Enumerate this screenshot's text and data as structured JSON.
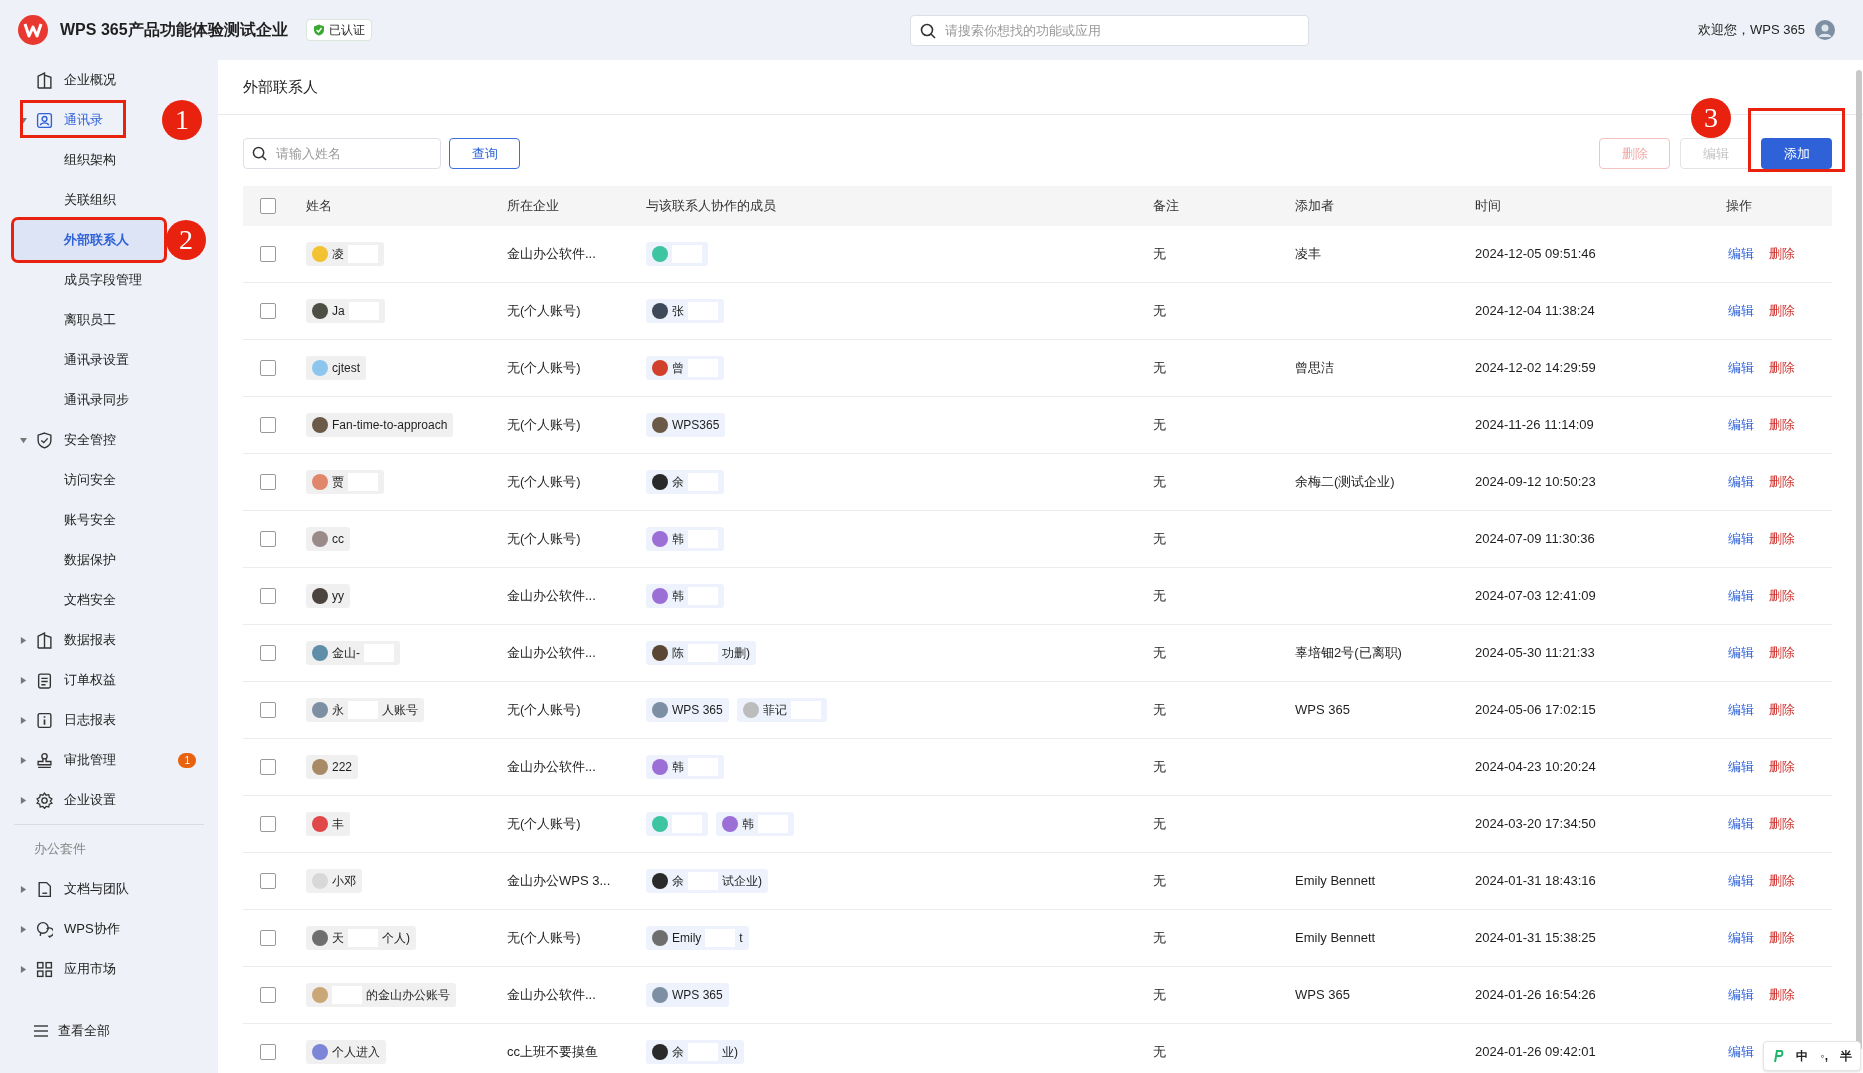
{
  "header": {
    "org_name": "WPS 365产品功能体验测试企业",
    "verified_badge": "已认证",
    "search": {
      "placeholder": "请搜索你想找的功能或应用"
    },
    "welcome": "欢迎您，WPS 365"
  },
  "sidebar": {
    "groups": [
      {
        "items": [
          {
            "label": "企业概况"
          },
          {
            "label": "通讯录",
            "expanded": true,
            "callout": "1",
            "children": [
              {
                "label": "组织架构",
                "selected": false
              },
              {
                "label": "关联组织",
                "selected": false
              },
              {
                "label": "外部联系人",
                "selected": true,
                "callout": "2"
              },
              {
                "label": "成员字段管理",
                "selected": false
              },
              {
                "label": "离职员工",
                "selected": false
              },
              {
                "label": "通讯录设置",
                "selected": false
              },
              {
                "label": "通讯录同步",
                "selected": false
              }
            ]
          },
          {
            "label": "安全管控",
            "expanded": true,
            "children": [
              {
                "label": "访问安全",
                "selected": false
              },
              {
                "label": "账号安全",
                "selected": false
              },
              {
                "label": "数据保护",
                "selected": false
              },
              {
                "label": "文档安全",
                "selected": false
              }
            ]
          },
          {
            "label": "数据报表",
            "expanded": false
          },
          {
            "label": "订单权益",
            "expanded": false
          },
          {
            "label": "日志报表",
            "expanded": false
          },
          {
            "label": "审批管理",
            "expanded": false,
            "badge": "1"
          },
          {
            "label": "企业设置",
            "expanded": false
          }
        ]
      },
      {
        "title": "办公套件",
        "items": [
          {
            "label": "文档与团队",
            "expanded": false
          },
          {
            "label": "WPS协作",
            "expanded": false
          },
          {
            "label": "应用市场",
            "expanded": false
          }
        ]
      }
    ],
    "footer": "查看全部"
  },
  "page_title": "外部联系人",
  "toolbar": {
    "search": {
      "placeholder": "请输入姓名"
    },
    "query_button": "查询",
    "buttons": [
      {
        "label": "删除",
        "kind": "delete",
        "disabled": true
      },
      {
        "label": "编辑",
        "kind": "edit",
        "disabled": true
      },
      {
        "label": "添加",
        "kind": "add",
        "disabled": false,
        "callout": "3"
      }
    ]
  },
  "table": {
    "all_checked": false,
    "columns": [
      "姓名",
      "所在企业",
      "与该联系人协作的成员",
      "备注",
      "添加者",
      "时间",
      "操作"
    ],
    "rows": [
      {
        "checked": false,
        "name": {
          "color": "#f2c230",
          "parts": [
            {
              "kind": "text",
              "text": "凌"
            },
            {
              "kind": "redaction"
            }
          ]
        },
        "company": "金山办公软件...",
        "members": [
          {
            "color": "#3cc5a0",
            "parts": [
              {
                "kind": "redaction"
              }
            ]
          }
        ],
        "note": "无",
        "added_by": "凌丰",
        "time": "2024-12-05 09:51:46",
        "actions": [
          {
            "label": "编辑",
            "kind": "edit"
          },
          {
            "label": "删除",
            "kind": "delete"
          }
        ]
      },
      {
        "checked": false,
        "name": {
          "color": "#4b4f44",
          "parts": [
            {
              "kind": "text",
              "text": "Ja"
            },
            {
              "kind": "redaction"
            }
          ]
        },
        "company": "无(个人账号)",
        "members": [
          {
            "color": "#3e4a5a",
            "parts": [
              {
                "kind": "text",
                "text": "张"
              },
              {
                "kind": "redaction"
              }
            ]
          }
        ],
        "note": "无",
        "time": "2024-12-04 11:38:24",
        "actions": [
          {
            "label": "编辑",
            "kind": "edit"
          },
          {
            "label": "删除",
            "kind": "delete"
          }
        ]
      },
      {
        "checked": false,
        "name": {
          "color": "#8ec5ec",
          "parts": [
            {
              "kind": "text",
              "text": "cjtest"
            }
          ]
        },
        "company": "无(个人账号)",
        "members": [
          {
            "color": "#d0402a",
            "parts": [
              {
                "kind": "text",
                "text": "曾"
              },
              {
                "kind": "redaction"
              }
            ]
          }
        ],
        "note": "无",
        "added_by": "曾思洁",
        "time": "2024-12-02 14:29:59",
        "actions": [
          {
            "label": "编辑",
            "kind": "edit"
          },
          {
            "label": "删除",
            "kind": "delete"
          }
        ]
      },
      {
        "checked": false,
        "name": {
          "color": "#6b5a48",
          "parts": [
            {
              "kind": "text",
              "text": "Fan-time-to-approach"
            }
          ]
        },
        "company": "无(个人账号)",
        "members": [
          {
            "color": "#6b5a48",
            "parts": [
              {
                "kind": "text",
                "text": "WPS365"
              }
            ]
          }
        ],
        "note": "无",
        "time": "2024-11-26 11:14:09",
        "actions": [
          {
            "label": "编辑",
            "kind": "edit"
          },
          {
            "label": "删除",
            "kind": "delete"
          }
        ]
      },
      {
        "checked": false,
        "name": {
          "color": "#e0866a",
          "parts": [
            {
              "kind": "text",
              "text": "贾"
            },
            {
              "kind": "redaction"
            }
          ]
        },
        "company": "无(个人账号)",
        "members": [
          {
            "color": "#2a2a2a",
            "parts": [
              {
                "kind": "text",
                "text": "余"
              },
              {
                "kind": "redaction"
              }
            ]
          }
        ],
        "note": "无",
        "added_by": "余梅二(测试企业)",
        "time": "2024-09-12 10:50:23",
        "actions": [
          {
            "label": "编辑",
            "kind": "edit"
          },
          {
            "label": "删除",
            "kind": "delete"
          }
        ]
      },
      {
        "checked": false,
        "name": {
          "color": "#9a8a8a",
          "parts": [
            {
              "kind": "text",
              "text": "cc"
            }
          ]
        },
        "company": "无(个人账号)",
        "members": [
          {
            "color": "#9b6fd6",
            "parts": [
              {
                "kind": "text",
                "text": "韩"
              },
              {
                "kind": "redaction"
              }
            ]
          }
        ],
        "note": "无",
        "time": "2024-07-09 11:30:36",
        "actions": [
          {
            "label": "编辑",
            "kind": "edit"
          },
          {
            "label": "删除",
            "kind": "delete"
          }
        ]
      },
      {
        "checked": false,
        "name": {
          "color": "#4a4440",
          "parts": [
            {
              "kind": "text",
              "text": "yy"
            }
          ]
        },
        "company": "金山办公软件...",
        "members": [
          {
            "color": "#9b6fd6",
            "parts": [
              {
                "kind": "text",
                "text": "韩"
              },
              {
                "kind": "redaction"
              }
            ]
          }
        ],
        "note": "无",
        "time": "2024-07-03 12:41:09",
        "actions": [
          {
            "label": "编辑",
            "kind": "edit"
          },
          {
            "label": "删除",
            "kind": "delete"
          }
        ]
      },
      {
        "checked": false,
        "name": {
          "color": "#5f8fa8",
          "parts": [
            {
              "kind": "text",
              "text": "金山-"
            },
            {
              "kind": "redaction"
            }
          ]
        },
        "company": "金山办公软件...",
        "members": [
          {
            "color": "#5a4632",
            "parts": [
              {
                "kind": "text",
                "text": "陈"
              },
              {
                "kind": "redaction"
              },
              {
                "kind": "text",
                "text": "功删)"
              }
            ]
          }
        ],
        "note": "无",
        "added_by": "辜培钿2号(已离职)",
        "time": "2024-05-30 11:21:33",
        "actions": [
          {
            "label": "编辑",
            "kind": "edit"
          },
          {
            "label": "删除",
            "kind": "delete"
          }
        ]
      },
      {
        "checked": false,
        "name": {
          "color": "#7d8fa3",
          "parts": [
            {
              "kind": "text",
              "text": "永"
            },
            {
              "kind": "redaction"
            },
            {
              "kind": "text",
              "text": "人账号"
            }
          ]
        },
        "company": "无(个人账号)",
        "members": [
          {
            "color": "#7d8fa3",
            "parts": [
              {
                "kind": "text",
                "text": "WPS 365"
              }
            ]
          },
          {
            "color": "#bcbcbc",
            "parts": [
              {
                "kind": "text",
                "text": "菲记"
              },
              {
                "kind": "redaction"
              }
            ]
          }
        ],
        "note": "无",
        "added_by": "WPS 365",
        "time": "2024-05-06 17:02:15",
        "actions": [
          {
            "label": "编辑",
            "kind": "edit"
          },
          {
            "label": "删除",
            "kind": "delete"
          }
        ]
      },
      {
        "checked": false,
        "name": {
          "color": "#a88a66",
          "parts": [
            {
              "kind": "text",
              "text": "222"
            }
          ]
        },
        "company": "金山办公软件...",
        "members": [
          {
            "color": "#9b6fd6",
            "parts": [
              {
                "kind": "text",
                "text": "韩"
              },
              {
                "kind": "redaction"
              }
            ]
          }
        ],
        "note": "无",
        "time": "2024-04-23 10:20:24",
        "actions": [
          {
            "label": "编辑",
            "kind": "edit"
          },
          {
            "label": "删除",
            "kind": "delete"
          }
        ]
      },
      {
        "checked": false,
        "name": {
          "color": "#e0484a",
          "parts": [
            {
              "kind": "text",
              "text": "丰"
            }
          ]
        },
        "company": "无(个人账号)",
        "members": [
          {
            "color": "#3cc5a0",
            "parts": [
              {
                "kind": "redaction"
              }
            ]
          },
          {
            "color": "#9b6fd6",
            "parts": [
              {
                "kind": "text",
                "text": "韩"
              },
              {
                "kind": "redaction"
              }
            ]
          }
        ],
        "note": "无",
        "time": "2024-03-20 17:34:50",
        "actions": [
          {
            "label": "编辑",
            "kind": "edit"
          },
          {
            "label": "删除",
            "kind": "delete"
          }
        ]
      },
      {
        "checked": false,
        "name": {
          "color": "#d8d8d8",
          "parts": [
            {
              "kind": "text",
              "text": "小邓"
            }
          ]
        },
        "company": "金山办公WPS 3...",
        "members": [
          {
            "color": "#2a2a2a",
            "parts": [
              {
                "kind": "text",
                "text": "余"
              },
              {
                "kind": "redaction"
              },
              {
                "kind": "text",
                "text": "试企业)"
              }
            ]
          }
        ],
        "note": "无",
        "added_by": "Emily Bennett",
        "time": "2024-01-31 18:43:16",
        "actions": [
          {
            "label": "编辑",
            "kind": "edit"
          },
          {
            "label": "删除",
            "kind": "delete"
          }
        ]
      },
      {
        "checked": false,
        "name": {
          "color": "#6e6e6e",
          "parts": [
            {
              "kind": "text",
              "text": "天"
            },
            {
              "kind": "redaction"
            },
            {
              "kind": "text",
              "text": "个人)"
            }
          ]
        },
        "company": "无(个人账号)",
        "members": [
          {
            "color": "#6e6e6e",
            "parts": [
              {
                "kind": "text",
                "text": "Emily"
              },
              {
                "kind": "redaction"
              },
              {
                "kind": "text",
                "text": "t"
              }
            ]
          }
        ],
        "note": "无",
        "added_by": "Emily Bennett",
        "time": "2024-01-31 15:38:25",
        "actions": [
          {
            "label": "编辑",
            "kind": "edit"
          },
          {
            "label": "删除",
            "kind": "delete"
          }
        ]
      },
      {
        "checked": false,
        "name": {
          "color": "#c9a777",
          "parts": [
            {
              "kind": "redaction"
            },
            {
              "kind": "text",
              "text": "的金山办公账号"
            }
          ]
        },
        "company": "金山办公软件...",
        "members": [
          {
            "color": "#7d8fa3",
            "parts": [
              {
                "kind": "text",
                "text": "WPS 365"
              }
            ]
          }
        ],
        "note": "无",
        "added_by": "WPS 365",
        "time": "2024-01-26 16:54:26",
        "actions": [
          {
            "label": "编辑",
            "kind": "edit"
          },
          {
            "label": "删除",
            "kind": "delete"
          }
        ]
      },
      {
        "checked": false,
        "name": {
          "color": "#7d86d6",
          "parts": [
            {
              "kind": "text",
              "text": "个人进入"
            }
          ]
        },
        "company": "cc上班不要摸鱼",
        "members": [
          {
            "color": "#2a2a2a",
            "parts": [
              {
                "kind": "text",
                "text": "余"
              },
              {
                "kind": "redaction"
              },
              {
                "kind": "text",
                "text": "业)"
              }
            ]
          }
        ],
        "note": "无",
        "time": "2024-01-26 09:42:01",
        "actions": [
          {
            "label": "编辑",
            "kind": "edit"
          }
        ]
      }
    ]
  },
  "ime_toolbar": [
    "中",
    "◦,",
    "半"
  ]
}
